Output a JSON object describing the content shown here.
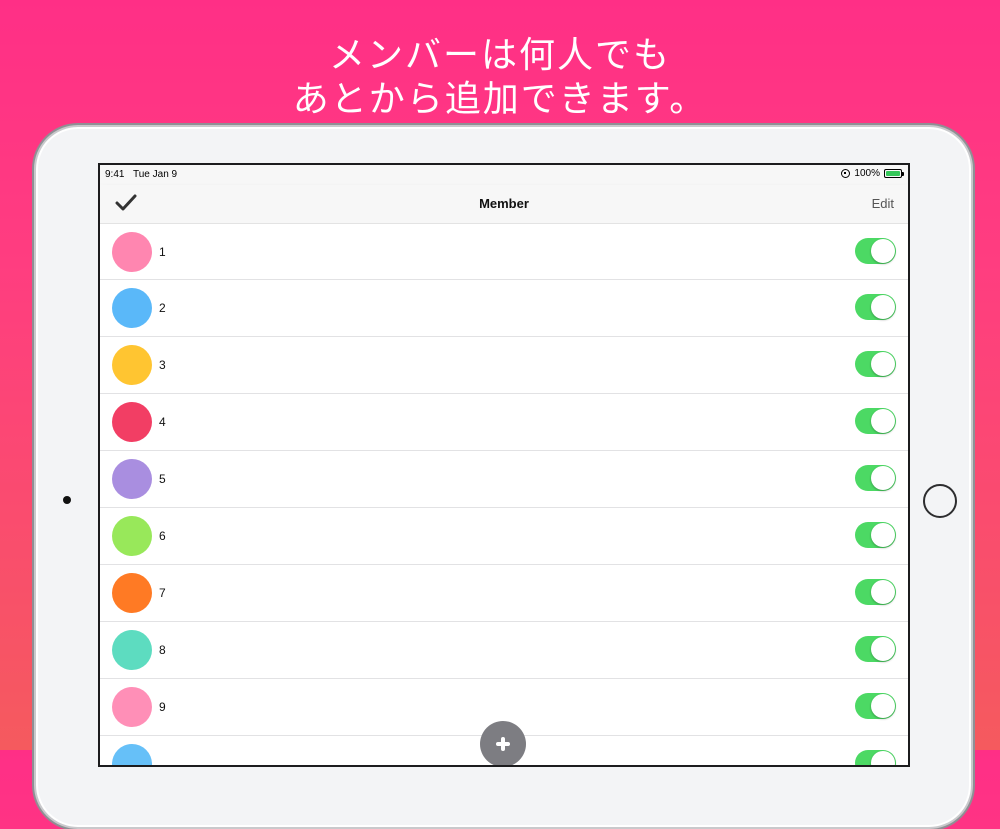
{
  "headline": {
    "line1": "メンバーは何人でも",
    "line2": "あとから追加できます。"
  },
  "status_bar": {
    "time": "9:41",
    "date": "Tue Jan 9",
    "battery": "100%"
  },
  "navbar": {
    "title": "Member",
    "edit_label": "Edit",
    "left_icon": "checkmark-icon"
  },
  "members": [
    {
      "name": "1",
      "color": "#ff86b0",
      "enabled": true
    },
    {
      "name": "2",
      "color": "#5ab8f9",
      "enabled": true
    },
    {
      "name": "3",
      "color": "#ffc531",
      "enabled": true
    },
    {
      "name": "4",
      "color": "#f23e64",
      "enabled": true
    },
    {
      "name": "5",
      "color": "#a98ee0",
      "enabled": true
    },
    {
      "name": "6",
      "color": "#98e85a",
      "enabled": true
    },
    {
      "name": "7",
      "color": "#ff7a24",
      "enabled": true
    },
    {
      "name": "8",
      "color": "#5ddcc0",
      "enabled": true
    },
    {
      "name": "9",
      "color": "#ff8fb7",
      "enabled": true
    },
    {
      "name": "",
      "color": "#66c0f8",
      "enabled": true
    }
  ],
  "add_button_icon": "plus-icon",
  "colors": {
    "background_top": "#ff2f86",
    "background_bottom": "#f55a5e",
    "toggle_on": "#4cd964"
  }
}
